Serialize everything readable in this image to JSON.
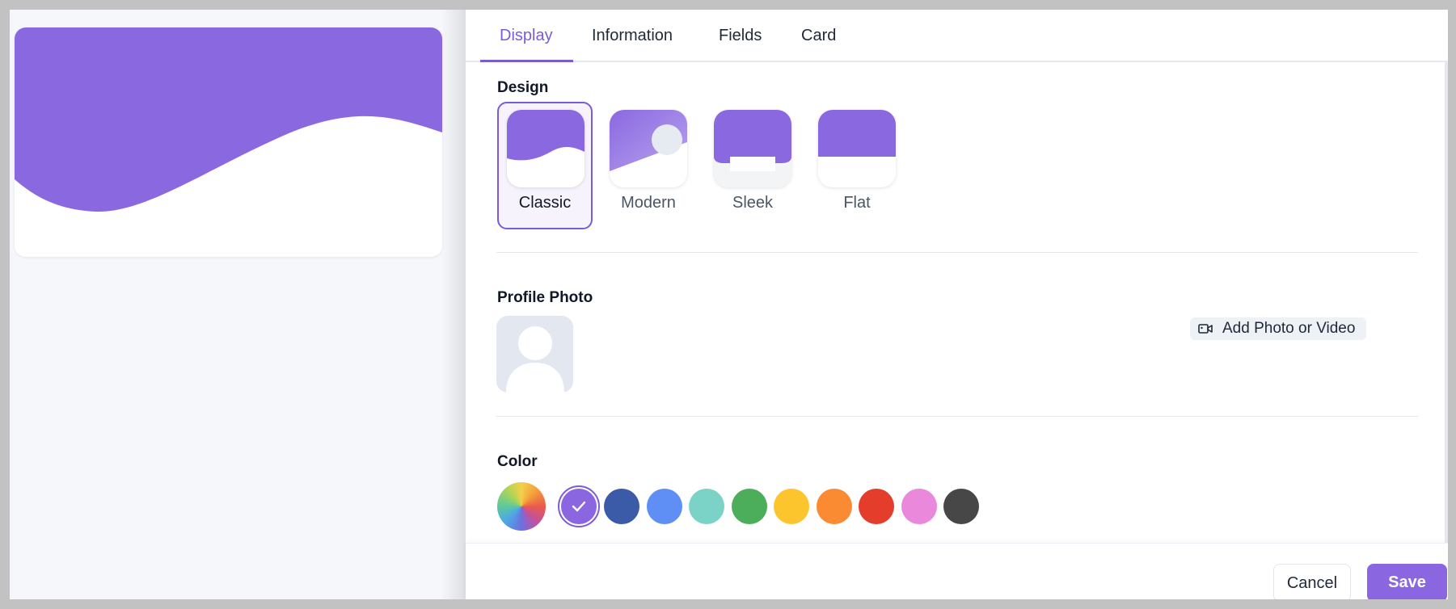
{
  "tabs": [
    {
      "label": "Display",
      "active": true
    },
    {
      "label": "Information",
      "active": false
    },
    {
      "label": "Fields",
      "active": false
    },
    {
      "label": "Card",
      "active": false
    }
  ],
  "design": {
    "title": "Design",
    "options": [
      {
        "label": "Classic",
        "selected": true
      },
      {
        "label": "Modern",
        "selected": false
      },
      {
        "label": "Sleek",
        "selected": false
      },
      {
        "label": "Flat",
        "selected": false
      }
    ]
  },
  "profile_photo": {
    "title": "Profile Photo",
    "add_button_label": "Add Photo or Video",
    "add_button_icon": "video-camera-icon",
    "avatar_icon": "person-placeholder-icon"
  },
  "color": {
    "title": "Color",
    "swatches": [
      {
        "name": "custom-gradient",
        "hex": "conic"
      },
      {
        "name": "purple",
        "hex": "#8b66e1",
        "selected": true
      },
      {
        "name": "dark-blue",
        "hex": "#3b5ba9"
      },
      {
        "name": "blue",
        "hex": "#5f8ff4"
      },
      {
        "name": "teal",
        "hex": "#7bd3c8"
      },
      {
        "name": "green",
        "hex": "#4cae5b"
      },
      {
        "name": "yellow",
        "hex": "#fcc52e"
      },
      {
        "name": "orange",
        "hex": "#fa8b32"
      },
      {
        "name": "red",
        "hex": "#e43d2c"
      },
      {
        "name": "pink",
        "hex": "#ea88dc"
      },
      {
        "name": "charcoal",
        "hex": "#474747"
      }
    ]
  },
  "footer": {
    "cancel_label": "Cancel",
    "save_label": "Save"
  },
  "theme": {
    "accent": "#8b66e1",
    "card_purple": "#8a68e0"
  }
}
